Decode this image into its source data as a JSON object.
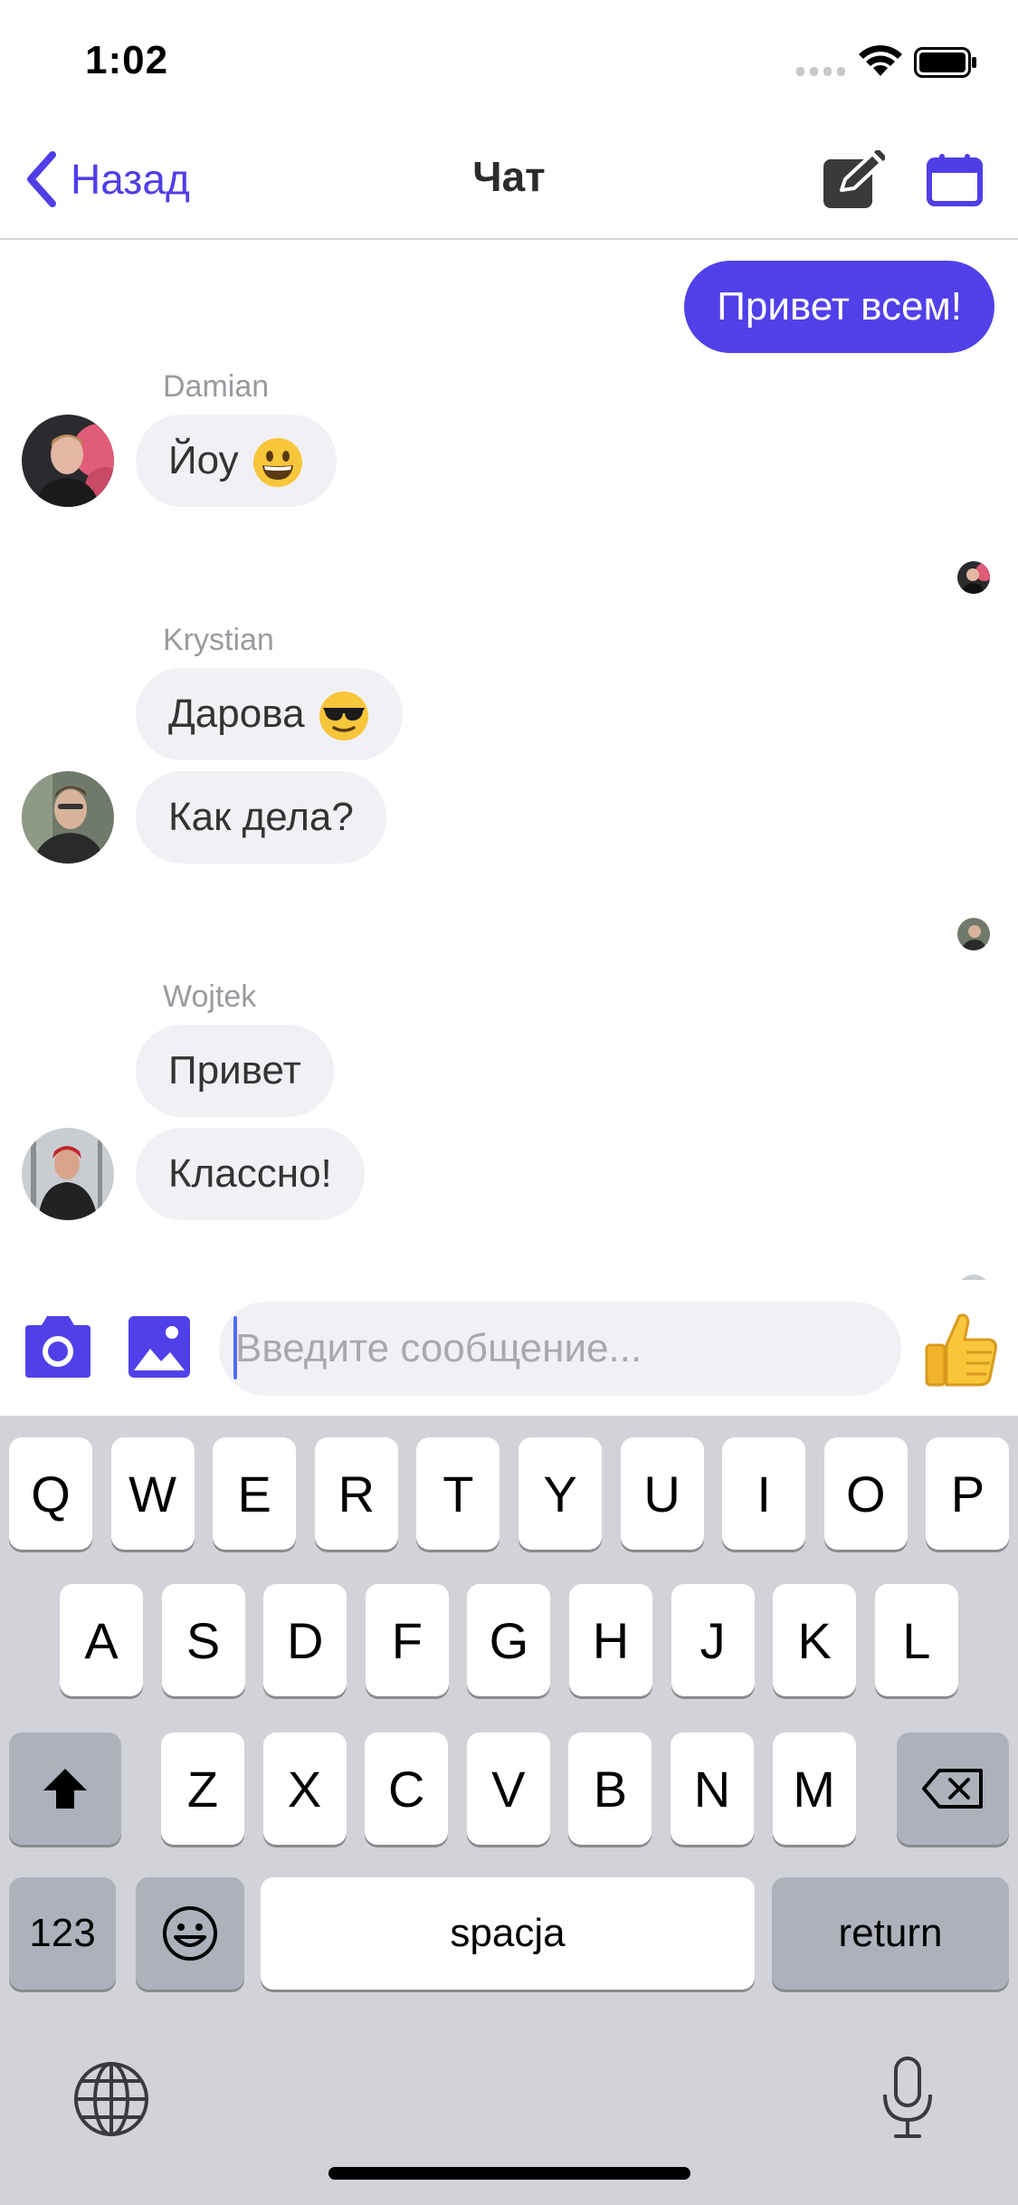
{
  "status_bar": {
    "time": "1:02"
  },
  "nav": {
    "back_label": "Назад",
    "title": "Чат"
  },
  "messages": {
    "outgoing_1": "Привет всем!",
    "damian": {
      "name": "Damian",
      "msg_1": "Йоу"
    },
    "krystian": {
      "name": "Krystian",
      "msg_1": "Дарова",
      "msg_2": "Как дела?"
    },
    "wojtek": {
      "name": "Wojtek",
      "msg_1": "Привет",
      "msg_2": "Классно!"
    }
  },
  "composer": {
    "placeholder": "Введите сообщение..."
  },
  "keyboard": {
    "row1": [
      "Q",
      "W",
      "E",
      "R",
      "T",
      "Y",
      "U",
      "I",
      "O",
      "P"
    ],
    "row2": [
      "A",
      "S",
      "D",
      "F",
      "G",
      "H",
      "J",
      "K",
      "L"
    ],
    "row3": [
      "Z",
      "X",
      "C",
      "V",
      "B",
      "N",
      "M"
    ],
    "numbers_label": "123",
    "space_label": "spacja",
    "return_label": "return"
  },
  "colors": {
    "accent": "#5040ea",
    "bubble_incoming": "#f0f0f5",
    "keyboard_bg": "#d1d3d9"
  },
  "icons": [
    "chevron-left-icon",
    "edit-icon",
    "calendar-icon",
    "camera-icon",
    "image-icon",
    "thumbs-up-icon",
    "shift-icon",
    "backspace-icon",
    "emoji-icon",
    "globe-icon",
    "microphone-icon"
  ]
}
